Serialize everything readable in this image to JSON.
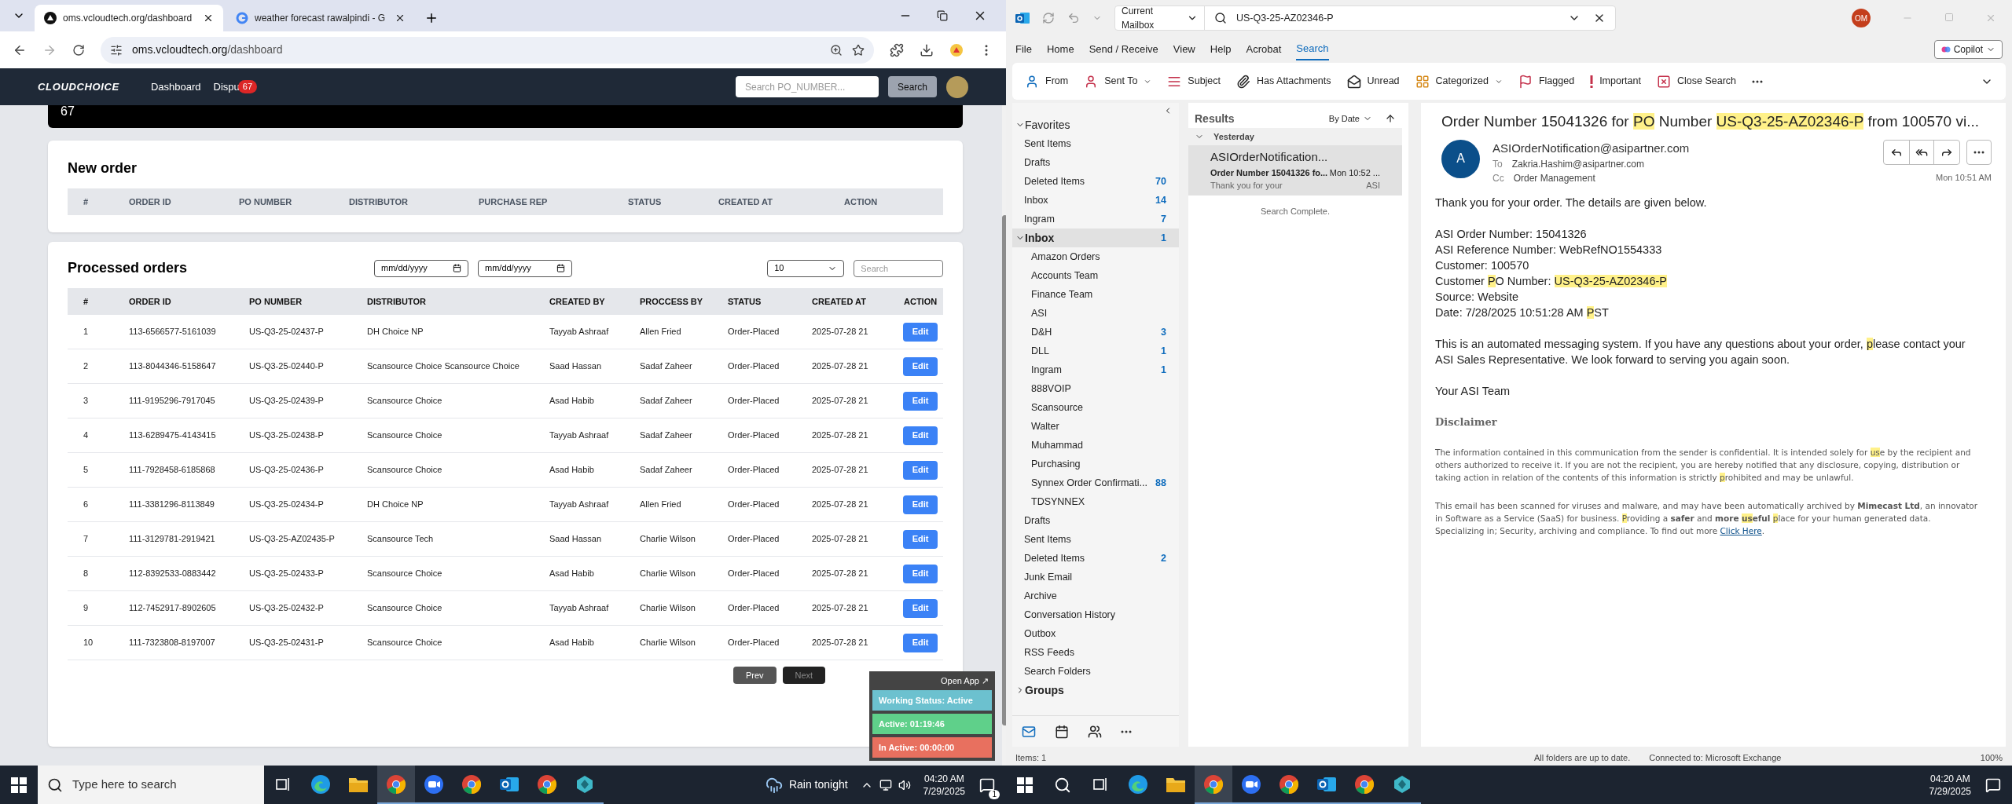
{
  "browser": {
    "tabs": [
      {
        "title": "oms.vcloudtech.org/dashboard",
        "kind": "app",
        "selected": true
      },
      {
        "title": "weather forecast rawalpindi - G",
        "kind": "google",
        "selected": false
      }
    ],
    "url": {
      "host": "oms.vcloudtech.org",
      "path": "/dashboard"
    }
  },
  "app": {
    "logo": "CLOUDCHOICE",
    "nav": [
      {
        "label": "Dashboard"
      },
      {
        "label": "Dispu",
        "badge": "67"
      }
    ],
    "search_placeholder": "Search PO_NUMBER...",
    "search_button": "Search",
    "top_card_value": "67",
    "new_order": {
      "title": "New order",
      "columns": [
        "#",
        "ORDER ID",
        "PO NUMBER",
        "DISTRIBUTOR",
        "PURCHASE REP",
        "STATUS",
        "CREATED AT",
        "ACTION"
      ]
    },
    "processed": {
      "title": "Processed orders",
      "date_from": "mm/dd/yyyy",
      "date_to": "mm/dd/yyyy",
      "page_size": "10",
      "search_placeholder": "Search",
      "columns": [
        "#",
        "ORDER ID",
        "PO NUMBER",
        "DISTRIBUTOR",
        "CREATED BY",
        "PROCCESS BY",
        "STATUS",
        "CREATED AT",
        "ACTION"
      ],
      "rows": [
        [
          "1",
          "113-6566577-5161039",
          "US-Q3-25-02437-P",
          "DH Choice NP",
          "Tayyab Ashraaf",
          "Allen Fried",
          "Order-Placed",
          "2025-07-28 21",
          "Edit"
        ],
        [
          "2",
          "113-8044346-5158647",
          "US-Q3-25-02440-P",
          "Scansource Choice Scansource Choice",
          "Saad Hassan",
          "Sadaf Zaheer",
          "Order-Placed",
          "2025-07-28 21",
          "Edit"
        ],
        [
          "3",
          "111-9195296-7917045",
          "US-Q3-25-02439-P",
          "Scansource Choice",
          "Asad Habib",
          "Sadaf Zaheer",
          "Order-Placed",
          "2025-07-28 21",
          "Edit"
        ],
        [
          "4",
          "113-6289475-4143415",
          "US-Q3-25-02438-P",
          "Scansource Choice",
          "Tayyab Ashraaf",
          "Sadaf Zaheer",
          "Order-Placed",
          "2025-07-28 21",
          "Edit"
        ],
        [
          "5",
          "111-7928458-6185868",
          "US-Q3-25-02436-P",
          "Scansource Choice",
          "Asad Habib",
          "Sadaf Zaheer",
          "Order-Placed",
          "2025-07-28 21",
          "Edit"
        ],
        [
          "6",
          "111-3381296-8113849",
          "US-Q3-25-02434-P",
          "DH Choice NP",
          "Tayyab Ashraaf",
          "Allen Fried",
          "Order-Placed",
          "2025-07-28 21",
          "Edit"
        ],
        [
          "7",
          "111-3129781-2919421",
          "US-Q3-25-AZ02435-P",
          "Scansource Tech",
          "Saad Hassan",
          "Charlie Wilson",
          "Order-Placed",
          "2025-07-28 21",
          "Edit"
        ],
        [
          "8",
          "112-8392533-0883442",
          "US-Q3-25-02433-P",
          "Scansource Choice",
          "Asad Habib",
          "Charlie Wilson",
          "Order-Placed",
          "2025-07-28 21",
          "Edit"
        ],
        [
          "9",
          "112-7452917-8902605",
          "US-Q3-25-02432-P",
          "Scansource Choice",
          "Tayyab Ashraaf",
          "Charlie Wilson",
          "Order-Placed",
          "2025-07-28 21",
          "Edit"
        ],
        [
          "10",
          "111-7323808-8197007",
          "US-Q3-25-02431-P",
          "Scansource Choice",
          "Asad Habib",
          "Charlie Wilson",
          "Order-Placed",
          "2025-07-28 21",
          "Edit"
        ]
      ],
      "pager": [
        {
          "label": "Prev",
          "disabled": false
        },
        {
          "label": "Next",
          "disabled": true
        }
      ]
    },
    "tracker": {
      "open": "Open App ↗",
      "lines": [
        {
          "text": "Working Status: Active",
          "color": "#6cc1cf"
        },
        {
          "text": "Active: 01:19:46",
          "color": "#5fd08a"
        },
        {
          "text": "In Active: 00:00:00",
          "color": "#e8705f"
        }
      ]
    }
  },
  "outlook": {
    "scope": "Current Mailbox",
    "search_value": "US-Q3-25-AZ02346-P",
    "avatar": "OM",
    "copilot": "Copilot",
    "menu": [
      {
        "label": "File",
        "selected": false
      },
      {
        "label": "Home",
        "selected": false
      },
      {
        "label": "Send / Receive",
        "selected": false
      },
      {
        "label": "View",
        "selected": false
      },
      {
        "label": "Help",
        "selected": false
      },
      {
        "label": "Acrobat",
        "selected": false
      },
      {
        "label": "Search",
        "selected": true
      }
    ],
    "ribbon": [
      {
        "label": "From",
        "kind": "from"
      },
      {
        "label": "Sent To",
        "kind": "sentto"
      },
      {
        "label": "Subject",
        "kind": "subject"
      },
      {
        "label": "Has Attachments",
        "kind": "attach"
      },
      {
        "label": "Unread",
        "kind": "unread"
      },
      {
        "label": "Categorized",
        "kind": "categorized"
      },
      {
        "label": "Flagged",
        "kind": "flag"
      },
      {
        "label": "Important",
        "kind": "important"
      },
      {
        "label": "Close Search",
        "kind": "close"
      }
    ],
    "folders": [
      {
        "label": "Favorites",
        "kind": "header",
        "expanded": true,
        "selected": false
      },
      {
        "label": "Sent Items",
        "kind": "fav",
        "selected": false
      },
      {
        "label": "Drafts",
        "kind": "fav",
        "selected": false
      },
      {
        "label": "Deleted Items",
        "kind": "fav",
        "count": "70",
        "selected": false
      },
      {
        "label": "Inbox",
        "kind": "fav",
        "count": "14",
        "selected": false
      },
      {
        "label": "Ingram",
        "kind": "fav",
        "count": "7",
        "selected": false
      },
      {
        "label": "Inbox",
        "kind": "header",
        "expanded": true,
        "count": "1",
        "selected": true,
        "children": [
          {
            "label": "Amazon Orders"
          },
          {
            "label": "Accounts Team"
          },
          {
            "label": "Finance Team"
          },
          {
            "label": "ASI"
          },
          {
            "label": "D&H",
            "count": "3"
          },
          {
            "label": "DLL",
            "count": "1"
          },
          {
            "label": "Ingram",
            "count": "1"
          },
          {
            "label": "888VOIP"
          },
          {
            "label": "Scansource"
          },
          {
            "label": "Walter"
          },
          {
            "label": "Muhammad"
          },
          {
            "label": "Purchasing"
          },
          {
            "label": "Synnex Order Confirmati...",
            "count": "88"
          },
          {
            "label": "TDSYNNEX"
          }
        ]
      },
      {
        "label": "Drafts",
        "kind": "fav",
        "selected": false
      },
      {
        "label": "Sent Items",
        "kind": "fav",
        "selected": false
      },
      {
        "label": "Deleted Items",
        "kind": "fav",
        "count": "2",
        "selected": false
      },
      {
        "label": "Junk Email",
        "kind": "fav",
        "selected": false
      },
      {
        "label": "Archive",
        "kind": "fav",
        "selected": false
      },
      {
        "label": "Conversation History",
        "kind": "fav",
        "selected": false
      },
      {
        "label": "Outbox",
        "kind": "fav",
        "selected": false
      },
      {
        "label": "RSS Feeds",
        "kind": "fav",
        "selected": false
      },
      {
        "label": "Search Folders",
        "kind": "fav",
        "selected": false
      },
      {
        "label": "Groups",
        "kind": "header",
        "expanded": false,
        "selected": false
      }
    ],
    "results": {
      "title": "Results",
      "sort": "By Date",
      "group": "Yesterday",
      "status": "Search Complete.",
      "items": [
        {
          "sender": "ASIOrderNotification...",
          "subject": "Order Number 15041326 fo...",
          "time": "Mon 10:52 ...",
          "preview": "Thank you for your",
          "folder": "ASI",
          "selected": true
        }
      ]
    },
    "message": {
      "subject": [
        {
          "t": "Order Number 15041326 for ",
          "hl": false
        },
        {
          "t": "PO",
          "hl": true
        },
        {
          "t": " Number ",
          "hl": false
        },
        {
          "t": "US-Q3-25-AZ02346-P",
          "hl": true
        },
        {
          "t": " from 100570 vi...",
          "hl": false
        }
      ],
      "avatar": "A",
      "from": "ASIOrderNotification@asipartner.com",
      "to_label": "To",
      "to": "Zakria.Hashim@asipartner.com",
      "cc_label": "Cc",
      "cc": "Order Management",
      "time": "Mon 10:51 AM",
      "body": [
        {
          "kind": "text",
          "lines": [
            [
              {
                "t": "Thank you for your order. The details are given below.",
                "hl": false
              }
            ]
          ]
        },
        {
          "kind": "text",
          "lines": [
            [
              {
                "t": "ASI Order Number: 15041326",
                "hl": false
              }
            ],
            [
              {
                "t": "ASI Reference Number: WebRefNO1554333",
                "hl": false
              }
            ],
            [
              {
                "t": "Customer: 100570",
                "hl": false
              }
            ],
            [
              {
                "t": "Customer ",
                "hl": false
              },
              {
                "t": "P",
                "hl": true
              },
              {
                "t": "O Number: ",
                "hl": false
              },
              {
                "t": "US-Q3-25-AZ02346-P",
                "hl": true
              }
            ],
            [
              {
                "t": "Source: Website",
                "hl": false
              }
            ],
            [
              {
                "t": "Date: 7/28/2025 10:51:28 AM ",
                "hl": false
              },
              {
                "t": "P",
                "hl": true
              },
              {
                "t": "ST",
                "hl": false
              }
            ]
          ]
        },
        {
          "kind": "text",
          "lines": [
            [
              {
                "t": "This is an automated messaging system. If you have any questions about your order, ",
                "hl": false
              },
              {
                "t": "p",
                "hl": true
              },
              {
                "t": "lease contact your ASI Sales Representative. We look forward to serving you again soon.",
                "hl": false
              }
            ]
          ]
        },
        {
          "kind": "text",
          "lines": [
            [
              {
                "t": "Your ASI Team",
                "hl": false
              }
            ]
          ]
        },
        {
          "kind": "heading",
          "lines": [
            [
              {
                "t": "Disclaimer",
                "hl": false
              }
            ]
          ]
        },
        {
          "kind": "small",
          "lines": [
            [
              {
                "t": "The information contained in this communication from the sender is confidential. It is intended solely for ",
                "hl": false
              },
              {
                "t": "us",
                "hl": true
              },
              {
                "t": "e by the recipient and others authorized to receive it. If you are not the recipient, you are hereby notified that any disclosure, copying, distribution or taking action in relation of the contents of this information is strictly ",
                "hl": false
              },
              {
                "t": "p",
                "hl": true
              },
              {
                "t": "rohibited and may be unlawful.",
                "hl": false
              }
            ]
          ]
        },
        {
          "kind": "small",
          "link": "Click Here",
          "after": ".",
          "lines": [
            [
              {
                "t": "This email has been scanned for viruses and malware, and may have been automatically archived by **Mimecast Ltd**, an innovator in Software as a Service (SaaS) for business. ",
                "hl": false
              },
              {
                "t": "P",
                "hl": true
              },
              {
                "t": "roviding a **safer** and **more** ",
                "hl": false
              },
              {
                "t": "**us**",
                "hl": true
              },
              {
                "t": "**eful** ",
                "hl": false
              },
              {
                "t": "p",
                "hl": true
              },
              {
                "t": "lace for your human generated data. Specializing in; Security, archiving and compliance. To find out more ",
                "hl": false
              }
            ]
          ]
        }
      ]
    },
    "status": {
      "items": "Items: 1",
      "sync": "All folders are up to date.",
      "connection": "Connected to: Microsoft Exchange",
      "zoom": "100%"
    }
  },
  "taskbars": [
    {
      "search_placeholder": "Type here to search",
      "weather": "Rain tonight",
      "time": "04:20 AM",
      "date": "7/29/2025",
      "notifications": "1",
      "apps": [
        {
          "kind": "taskview",
          "selected": false
        },
        {
          "kind": "edge",
          "selected": false
        },
        {
          "kind": "explorer",
          "selected": false
        },
        {
          "kind": "chrome",
          "selected": true
        },
        {
          "kind": "zoom",
          "selected": false
        },
        {
          "kind": "chrome",
          "selected": false
        },
        {
          "kind": "outlook",
          "selected": false
        },
        {
          "kind": "chrome",
          "selected": false
        },
        {
          "kind": "app",
          "selected": false
        }
      ]
    },
    {
      "time": "04:20 AM",
      "date": "7/29/2025",
      "apps": [
        {
          "kind": "taskview",
          "selected": false
        },
        {
          "kind": "edge",
          "selected": false
        },
        {
          "kind": "explorer",
          "selected": false
        },
        {
          "kind": "chrome",
          "selected": true
        },
        {
          "kind": "zoom",
          "selected": false
        },
        {
          "kind": "chrome",
          "selected": false
        },
        {
          "kind": "outlook",
          "selected": false
        },
        {
          "kind": "chrome",
          "selected": false
        },
        {
          "kind": "app",
          "selected": false
        }
      ]
    }
  ]
}
